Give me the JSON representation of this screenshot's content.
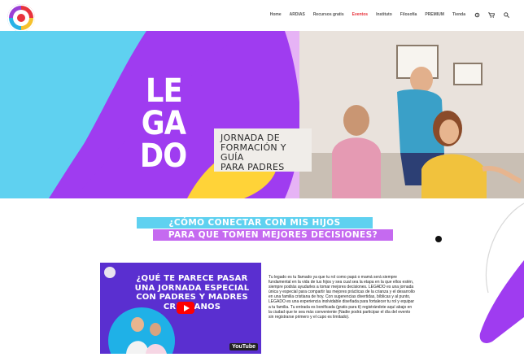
{
  "nav": {
    "items": [
      {
        "label": "Home",
        "active": false
      },
      {
        "label": "ARDIAS",
        "active": false
      },
      {
        "label": "Recursos gratis",
        "active": false
      },
      {
        "label": "Eventos",
        "active": true
      },
      {
        "label": "Instituto",
        "active": false
      },
      {
        "label": "Filosofía",
        "active": false
      },
      {
        "label": "PREMIUM",
        "active": false
      },
      {
        "label": "Tienda",
        "active": false
      }
    ],
    "icons": [
      "gear-icon",
      "cart-icon",
      "search-icon"
    ]
  },
  "hero": {
    "word_lines": [
      "LE",
      "GA",
      "DO"
    ],
    "title_lines": [
      "JORNADA DE",
      "FORMACIÓN Y GUÍA",
      "PARA PADRES"
    ]
  },
  "question": {
    "line1": "¿CÓMO CONECTAR CON MIS HIJOS",
    "line2": "PARA QUE TOMEN MEJORES DECISIONES?"
  },
  "video": {
    "headline": [
      "¿QUÉ TE PARECE PASAR",
      "UNA JORNADA ESPECIAL",
      "CON PADRES Y MADRES",
      "CRISTIANOS"
    ],
    "badge": "YouTube"
  },
  "description": "Tu legado es tu llamado ya que tu rol como papá o mamá será siempre fundamental en la vida de tus hijos y sea cual sea la etapa en la que ellos estén, siempre podrás ayudarles a tomar mejores decisiones. LEGADO es una jornada única y especial para compartir las mejores prácticas de la crianza y el desarrollo en una familia cristiana de hoy. Con sugerencias divertidas, bíblicas y al punto, LEGADO es una experiencia inolvidable diseñada para fortalecer tu rol y equipar a tu familia. Tu entrada es bonificada (gratis para ti) registrándote aquí abajo en la ciudad que te sea más conveniente (Nadie podrá participar el día del evento sin registrarse primero y el cupo es limitado).",
  "colors": {
    "purple": "#9f3cf0",
    "cyan": "#5fd1f0",
    "violet": "#c56af0",
    "yellow": "#ffd338",
    "accent_red": "#e8333c"
  }
}
